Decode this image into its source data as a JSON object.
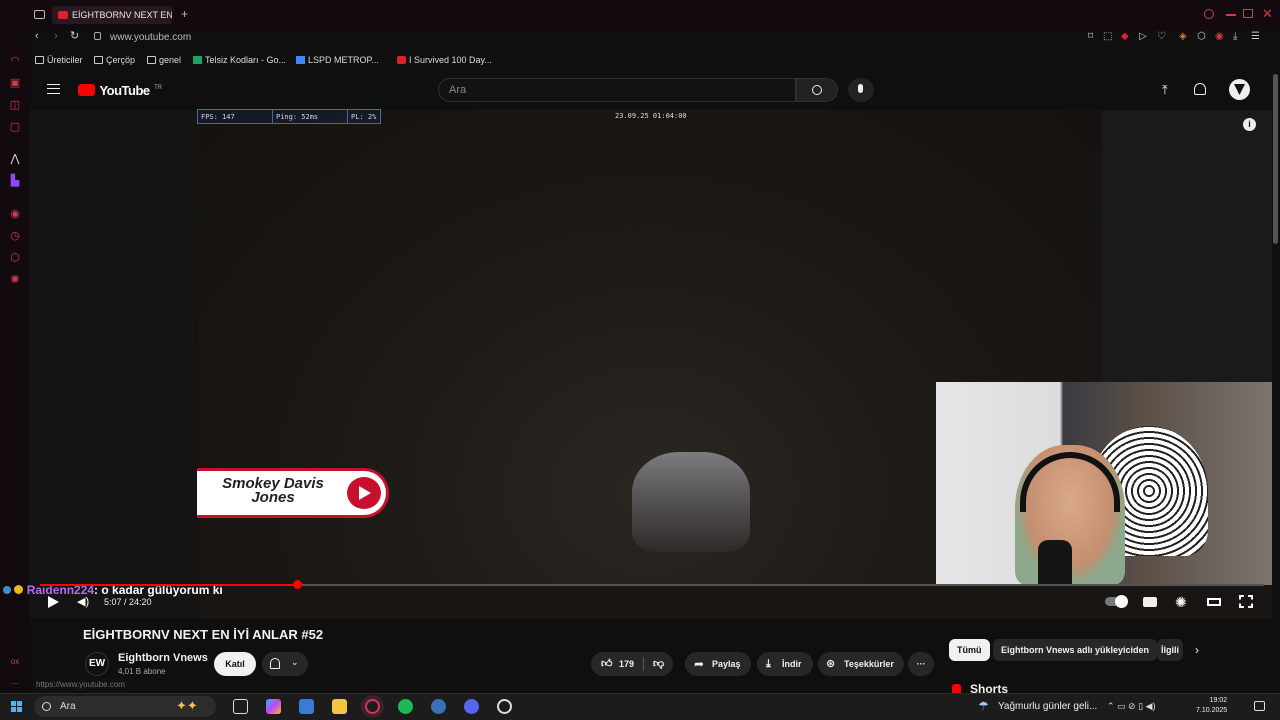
{
  "browser": {
    "tab_title": "EİGHTBORNV NEXT EN İY",
    "url": "www.youtube.com",
    "bookmarks": [
      {
        "label": "Üreticiler",
        "icon": "folder-icon"
      },
      {
        "label": "Çerçöp",
        "icon": "folder-icon"
      },
      {
        "label": "genel",
        "icon": "folder-icon"
      },
      {
        "label": "Telsiz Kodları - Go...",
        "icon": "sheets-icon"
      },
      {
        "label": "LSPD METROP...",
        "icon": "docs-icon"
      },
      {
        "label": "I Survived 100 Day...",
        "icon": "youtube-icon"
      }
    ],
    "status_url": "https://www.youtube.com"
  },
  "youtube": {
    "logo_text": "YouTube",
    "logo_region": "TR",
    "search_placeholder": "Ara"
  },
  "video": {
    "hud_fps": "FPS: 147",
    "hud_ping": "Ping: 52ms",
    "hud_pl": "PL: 2%",
    "timestamp": "23.09.25 01:04:00",
    "overlay_name": "Smokey Davis Jones",
    "chat_user": "Raidenn224",
    "chat_message": ": o kadar gülüyorum ki",
    "time_display": "5:07 / 24:20",
    "progress_fraction": 0.21
  },
  "details": {
    "title": "EİGHTBORNV NEXT EN İYİ ANLAR #52",
    "channel_name": "Eightborn Vnews",
    "channel_avatar": "EW",
    "subscribers": "4,01 B abone",
    "join_label": "Katıl",
    "likes": "179",
    "share_label": "Paylaş",
    "download_label": "İndir",
    "thanks_label": "Teşekkürler",
    "more_label": "···"
  },
  "related": {
    "chips": [
      "Tümü",
      "Eightborn Vnews adlı yükleyiciden",
      "İlgili"
    ],
    "shorts_label": "Shorts"
  },
  "taskbar": {
    "search_label": "Ara",
    "weather": "Yağmurlu günler geli...",
    "time": "19:02",
    "date": "7.10.2025"
  },
  "colors": {
    "accent": "#ff0000",
    "sidebar_icon": "#d23a4f",
    "chat_user": "#b36cf0"
  }
}
